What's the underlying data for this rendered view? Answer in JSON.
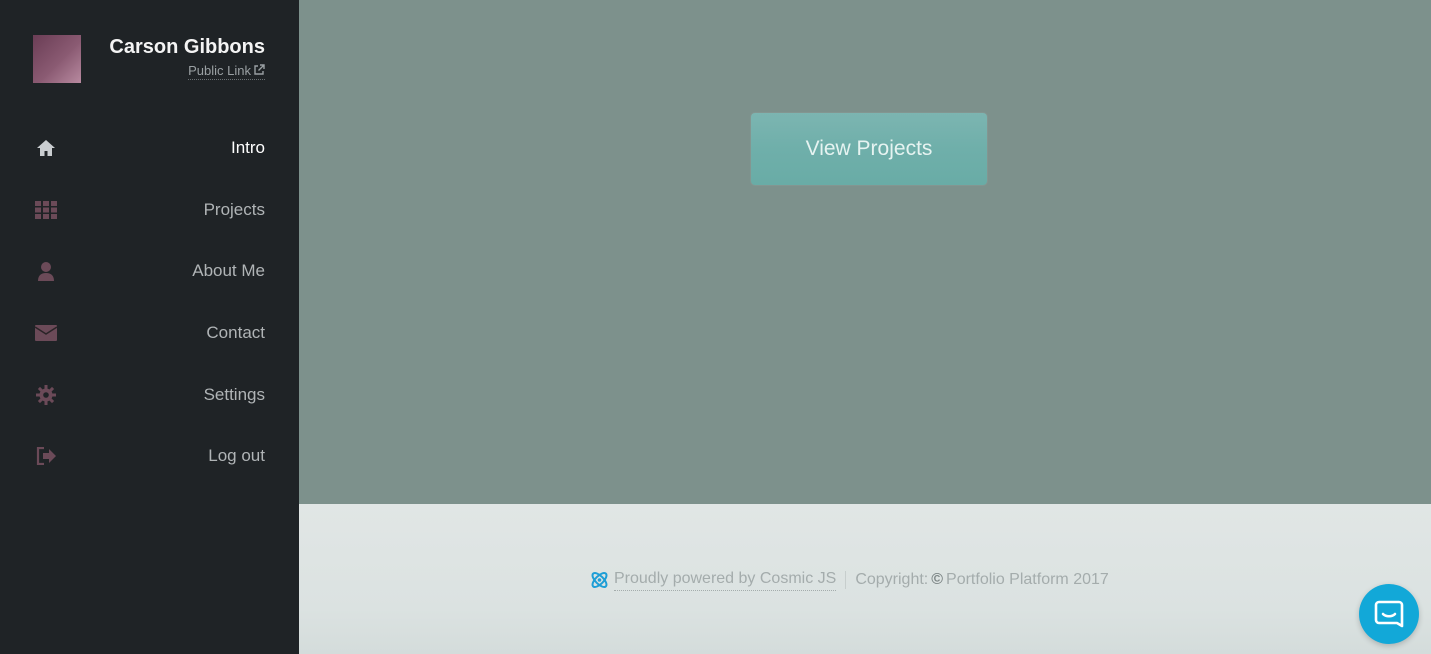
{
  "profile": {
    "name": "Carson Gibbons",
    "public_link_label": "Public Link",
    "public_link_icon": "external-link-icon"
  },
  "nav": {
    "items": [
      {
        "label": "Intro",
        "icon": "home-icon",
        "active": true
      },
      {
        "label": "Projects",
        "icon": "grid-icon",
        "active": false
      },
      {
        "label": "About Me",
        "icon": "user-icon",
        "active": false
      },
      {
        "label": "Contact",
        "icon": "envelope-icon",
        "active": false
      },
      {
        "label": "Settings",
        "icon": "gear-icon",
        "active": false
      },
      {
        "label": "Log out",
        "icon": "sign-out-icon",
        "active": false
      }
    ]
  },
  "main": {
    "cta_label": "View Projects"
  },
  "footer": {
    "powered_label": "Proudly powered by Cosmic JS",
    "copyright_prefix": "Copyright:",
    "copyright_symbol": "©",
    "copyright_text": "Portfolio Platform 2017"
  },
  "colors": {
    "sidebar_bg": "#1f2326",
    "main_bg": "#7d918c",
    "button_bg": "#6fafaa",
    "footer_bg": "#dde3e2",
    "chat_bg": "#12a8d8"
  },
  "chat": {
    "icon": "chat-bubble-icon"
  }
}
